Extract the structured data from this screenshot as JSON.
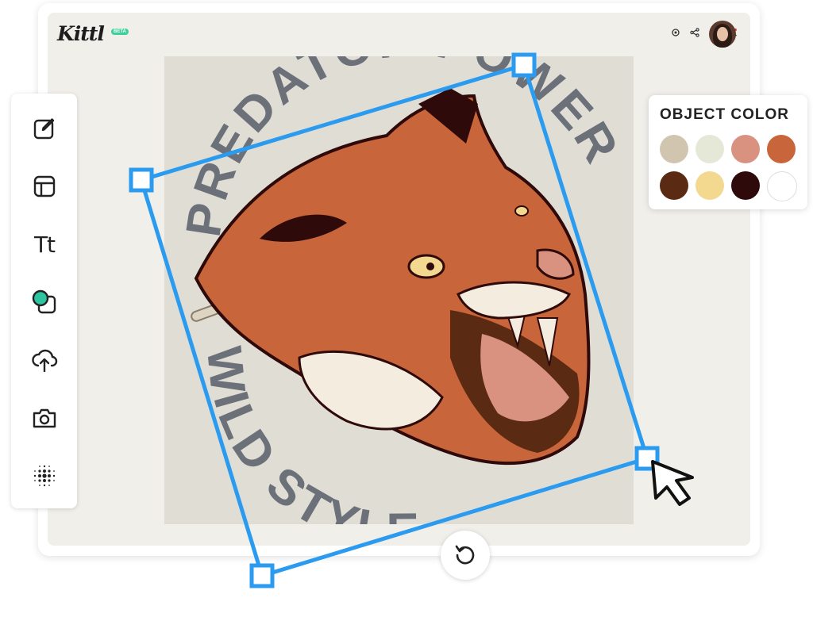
{
  "app": {
    "logo_text": "Kittl",
    "beta_badge": "BETA"
  },
  "header": {
    "icons": [
      "settings-icon",
      "share-icon",
      "download-icon",
      "notification-icon"
    ],
    "avatar": "user-avatar"
  },
  "sidebar": {
    "tools": [
      {
        "name": "edit-tool",
        "icon": "pencil-square-icon"
      },
      {
        "name": "templates-tool",
        "icon": "layout-icon"
      },
      {
        "name": "text-tool",
        "icon": "text-icon",
        "label": "Tt"
      },
      {
        "name": "elements-tool",
        "icon": "shapes-icon"
      },
      {
        "name": "uploads-tool",
        "icon": "cloud-upload-icon"
      },
      {
        "name": "photos-tool",
        "icon": "camera-icon"
      },
      {
        "name": "patterns-tool",
        "icon": "halftone-dots-icon"
      }
    ]
  },
  "artwork": {
    "text_top": "PREDATOR POWER",
    "text_bottom": "WILD STYLE"
  },
  "object_color_panel": {
    "title": "OBJECT COLOR",
    "swatches": [
      "#d1c5b0",
      "#e6e8d7",
      "#d99180",
      "#c8653a",
      "#5b2a12",
      "#f3d88f",
      "#2e0a0a",
      "#ffffff"
    ]
  },
  "colors": {
    "selection": "#2b9bf0",
    "app_background": "#f1efea",
    "canvas_background": "#e0ddd5"
  },
  "rotate_button": {
    "icon": "rotate-icon"
  }
}
